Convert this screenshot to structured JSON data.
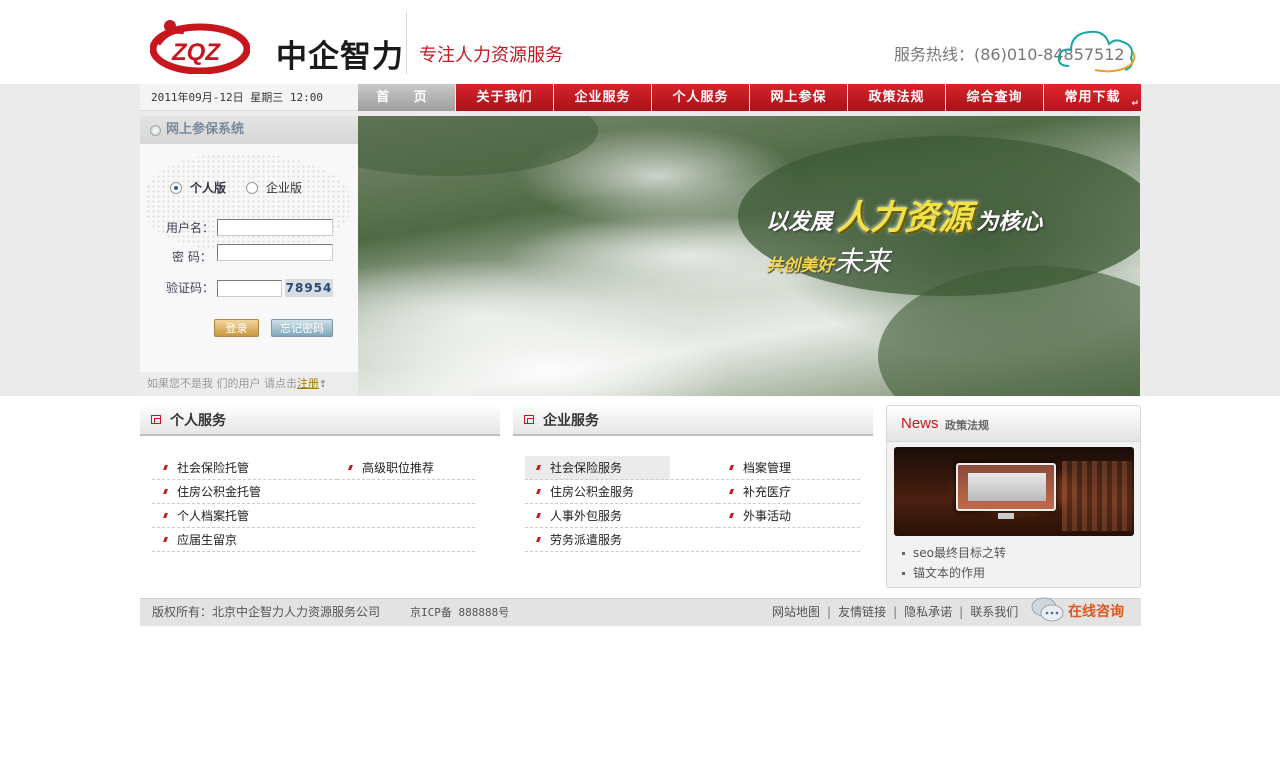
{
  "header": {
    "logo_letters": "ZQZ",
    "logo_name": "中企智力",
    "slogan": "专注人力资源服务",
    "hotline": "服务热线：(86)010-84857512"
  },
  "datebar": "2011年09月-12日  星期三  12:00",
  "nav": {
    "items": [
      {
        "label": "首 页"
      },
      {
        "label": "关于我们"
      },
      {
        "label": "企业服务"
      },
      {
        "label": "个人服务"
      },
      {
        "label": "网上参保"
      },
      {
        "label": "政策法规"
      },
      {
        "label": "综合查询"
      },
      {
        "label": "常用下载"
      }
    ],
    "corner_glyph": "↵"
  },
  "login": {
    "title": "网上参保系统",
    "radio_personal": "个人版",
    "radio_enterprise": "企业版",
    "username_label": "用户名：",
    "password_label": "密  码：",
    "captcha_label": "验证码：",
    "username_value": "",
    "password_value": "",
    "captcha_value": "",
    "captcha_code": "78954",
    "login_button": "登录",
    "forgot_button": "忘记密码",
    "footer_text": "如果您不是我 们的用户 请点击",
    "register_link": "注册",
    "footer_mark": "❢"
  },
  "banner": {
    "line1_a": "以发展",
    "line1_b": "人力资源",
    "line1_c": "为核心",
    "line2_a": "共创美好",
    "line2_b": "未来"
  },
  "personal": {
    "title": "个人服务",
    "items": [
      "社会保险托管",
      "高级职位推荐",
      "住房公积金托管",
      "个人档案托管",
      "应届生留京"
    ]
  },
  "enterprise": {
    "title": "企业服务",
    "items": [
      "社会保险服务",
      "档案管理",
      "住房公积金服务",
      "补充医疗",
      "人事外包服务",
      "外事活动",
      "劳务派遣服务"
    ]
  },
  "news": {
    "title_en": "News",
    "title_cn": "政策法规",
    "items": [
      "seo最终目标之转",
      "锚文本的作用"
    ]
  },
  "footer": {
    "copyright": "版权所有：北京中企智力人力资源服务公司",
    "icp": "京ICP备 888888号",
    "links": [
      "网站地图",
      "友情链接",
      "隐私承诺",
      "联系我们"
    ],
    "consult": "在线咨询"
  },
  "colors": {
    "brand_red": "#c8161e",
    "nav_home": "#b0b0b0",
    "consult_orange": "#e0561e"
  }
}
